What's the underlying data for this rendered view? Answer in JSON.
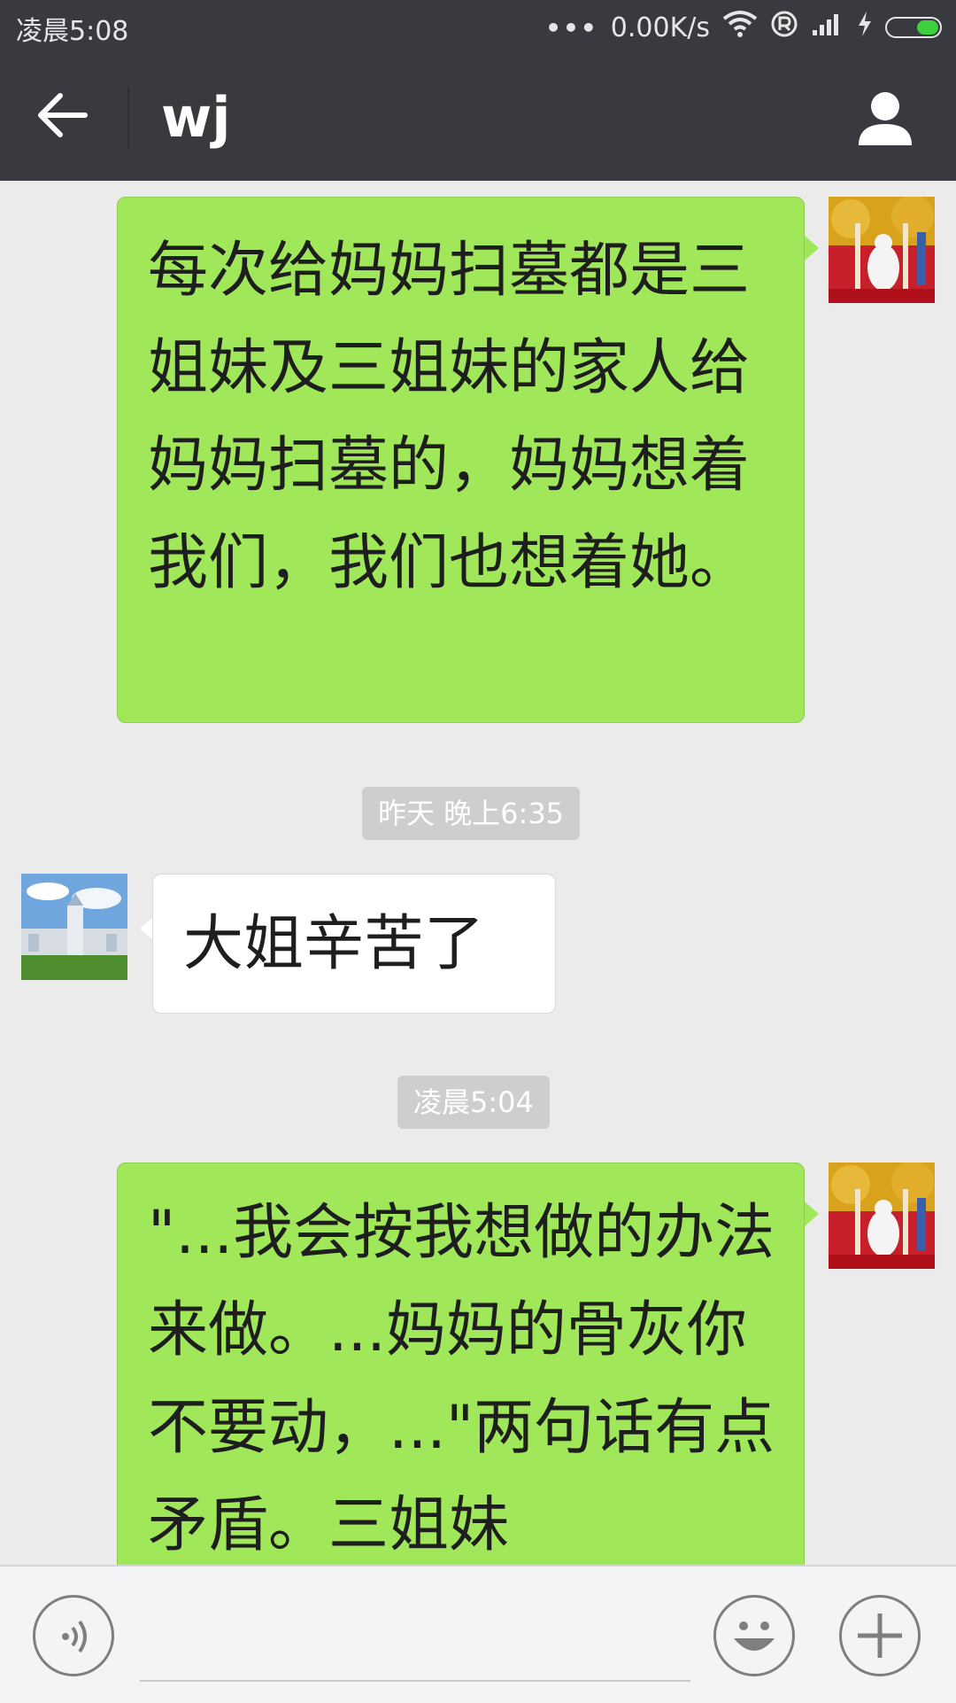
{
  "status_bar": {
    "time": "凌晨5:08",
    "dots": "•••",
    "speed": "0.00K/s",
    "icons": [
      "wifi-icon",
      "registered-icon",
      "signal-icon",
      "charging-icon",
      "battery-icon"
    ]
  },
  "header": {
    "title": "wj",
    "icons": [
      "back-arrow-icon",
      "profile-icon"
    ]
  },
  "messages": [
    {
      "sender": "me",
      "text": "每次给妈妈扫墓都是三姐妹及三姐妹的家人给妈妈扫墓的，妈妈想着我们，我们也想着她。"
    },
    {
      "timestamp": "昨天 晚上6:35"
    },
    {
      "sender": "other",
      "text": "大姐辛苦了"
    },
    {
      "timestamp": "凌晨5:04"
    },
    {
      "sender": "me",
      "text": "\"...我会按我想做的办法来做。...妈妈的骨灰你不要动，...\"两句话有点矛盾。三姐妹"
    }
  ],
  "input_bar": {
    "icons": [
      "voice-icon",
      "emoji-icon",
      "plus-icon"
    ]
  },
  "colors": {
    "header_bg": "#393a3f",
    "chat_bg": "#ebebeb",
    "my_bubble": "#a0e75a",
    "other_bubble": "#ffffff",
    "timestamp_bg": "#cecece"
  }
}
